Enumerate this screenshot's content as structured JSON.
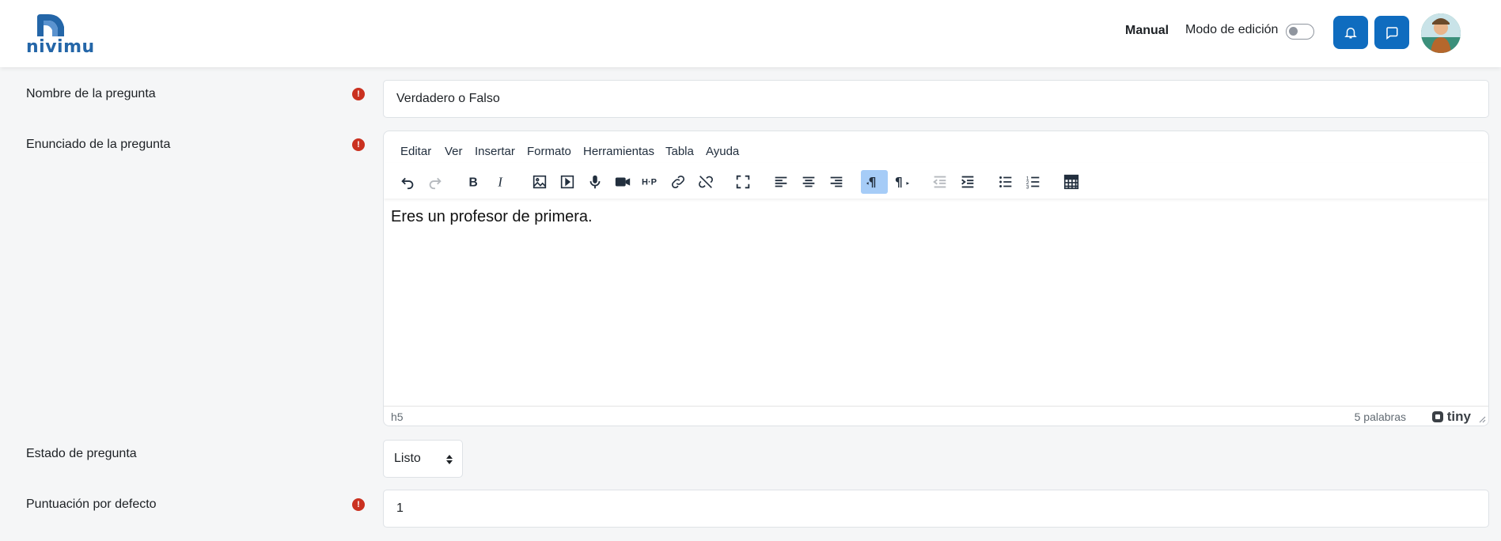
{
  "header": {
    "logo_text": "nivimu",
    "manual_label": "Manual",
    "edit_mode_label": "Modo de edición",
    "edit_mode_on": false,
    "accent": "#0f6cbf"
  },
  "form": {
    "name": {
      "label": "Nombre de la pregunta",
      "value": "Verdadero o Falso",
      "required": true
    },
    "statement": {
      "label": "Enunciado de la pregunta",
      "required": true
    },
    "state": {
      "label": "Estado de pregunta",
      "value": "Listo"
    },
    "score": {
      "label": "Puntuación por defecto",
      "value": "1",
      "required": true
    }
  },
  "editor": {
    "menu": [
      "Editar",
      "Ver",
      "Insertar",
      "Formato",
      "Herramientas",
      "Tabla",
      "Ayuda"
    ],
    "content": "Eres un profesor de primera.",
    "status_path": "h5",
    "word_count": "5 palabras",
    "brand": "tiny",
    "toolbar_icons": [
      "undo-icon",
      "redo-icon",
      "bold-icon",
      "italic-icon",
      "image-icon",
      "media-icon",
      "microphone-icon",
      "video-camera-icon",
      "h5p-icon",
      "link-icon",
      "unlink-icon",
      "fullscreen-icon",
      "align-left-icon",
      "align-center-icon",
      "align-right-icon",
      "ltr-icon",
      "rtl-icon",
      "outdent-icon",
      "indent-icon",
      "bullet-list-icon",
      "numbered-list-icon",
      "table-icon"
    ]
  }
}
